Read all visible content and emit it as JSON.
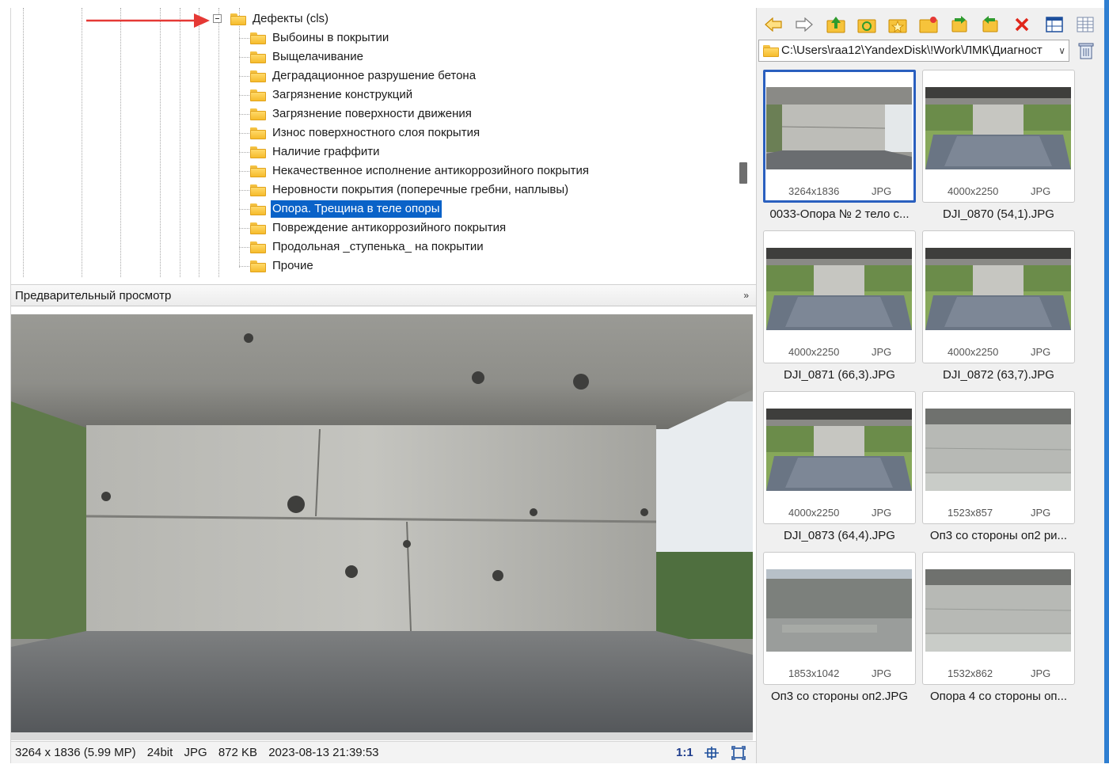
{
  "tree": {
    "root": {
      "label": "Дефекты (cls)"
    },
    "children": [
      {
        "label": "Выбоины в покрытии"
      },
      {
        "label": "Выщелачивание"
      },
      {
        "label": "Деградационное разрушение бетона"
      },
      {
        "label": "Загрязнение конструкций"
      },
      {
        "label": "Загрязнение поверхности движения"
      },
      {
        "label": "Износ поверхностного слоя покрытия"
      },
      {
        "label": "Наличие граффити"
      },
      {
        "label": "Некачественное исполнение антикоррозийного покрытия"
      },
      {
        "label": "Неровности покрытия (поперечные гребни, наплывы)"
      },
      {
        "label": "Опора. Трещина в теле опоры",
        "selected": true
      },
      {
        "label": "Повреждение антикоррозийного покрытия"
      },
      {
        "label": "Продольная _ступенька_ на покрытии"
      },
      {
        "label": "Прочие"
      }
    ]
  },
  "preview": {
    "header": "Предварительный просмотр"
  },
  "status": {
    "resolution": "3264 x 1836 (5.99 MP)",
    "bitdepth": "24bit",
    "format": "JPG",
    "size": "872 KB",
    "datetime": "2023-08-13 21:39:53",
    "zoom": "1:1"
  },
  "browser": {
    "path": "C:\\Users\\raa12\\YandexDisk\\!Work\\ЛМК\\Диагност"
  },
  "thumbnails": [
    {
      "dims": "3264x1836",
      "type": "JPG",
      "name": "0033-Опора № 2 тело с...",
      "selected": true
    },
    {
      "dims": "4000x2250",
      "type": "JPG",
      "name": "DJI_0870 (54,1).JPG"
    },
    {
      "dims": "4000x2250",
      "type": "JPG",
      "name": "DJI_0871 (66,3).JPG"
    },
    {
      "dims": "4000x2250",
      "type": "JPG",
      "name": "DJI_0872 (63,7).JPG"
    },
    {
      "dims": "4000x2250",
      "type": "JPG",
      "name": "DJI_0873 (64,4).JPG"
    },
    {
      "dims": "1523x857",
      "type": "JPG",
      "name": "Оп3 со стороны оп2 ри..."
    },
    {
      "dims": "1853x1042",
      "type": "JPG",
      "name": "Оп3 со стороны оп2.JPG"
    },
    {
      "dims": "1532x862",
      "type": "JPG",
      "name": "Опора 4 со стороны оп..."
    }
  ],
  "colors": {
    "selection": "#0a62c8",
    "thumb_selected_border": "#2a5fbf",
    "arrow": "#e53935",
    "window_edge": "#2f7fd1"
  },
  "icons": [
    "back-arrow-icon",
    "forward-arrow-icon",
    "folder-up-icon",
    "refresh-folder-icon",
    "favorites-icon",
    "new-folder-icon",
    "copy-to-folder-icon",
    "move-to-folder-icon",
    "delete-icon",
    "view-mode-icon",
    "details-view-icon",
    "trash-icon",
    "fit-window-icon",
    "fullscreen-icon",
    "collapse-chevron-icon"
  ]
}
